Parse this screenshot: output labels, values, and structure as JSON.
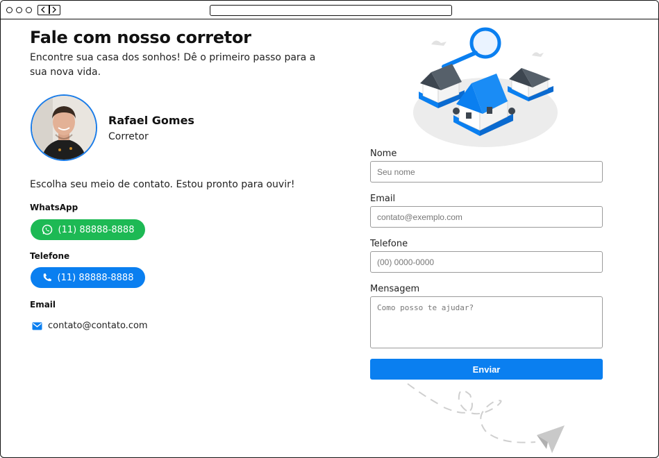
{
  "header": {
    "title": "Fale com nosso corretor",
    "subtitle": "Encontre sua casa dos sonhos! Dê o primeiro passo para a sua nova vida."
  },
  "agent": {
    "name": "Rafael Gomes",
    "role": "Corretor"
  },
  "contact": {
    "prompt": "Escolha seu meio de contato. Estou pronto para ouvir!",
    "whatsapp_label": "WhatsApp",
    "whatsapp_number": "(11) 88888-8888",
    "phone_label": "Telefone",
    "phone_number": "(11) 88888-8888",
    "email_label": "Email",
    "email_value": "contato@contato.com"
  },
  "form": {
    "name_label": "Nome",
    "name_placeholder": "Seu nome",
    "email_label": "Email",
    "email_placeholder": "contato@exemplo.com",
    "phone_label": "Telefone",
    "phone_placeholder": "(00) 0000-0000",
    "message_label": "Mensagem",
    "message_placeholder": "Como posso te ajudar?",
    "submit_label": "Enviar"
  },
  "colors": {
    "accent_blue": "#0a7ff0",
    "whatsapp_green": "#1db954"
  }
}
